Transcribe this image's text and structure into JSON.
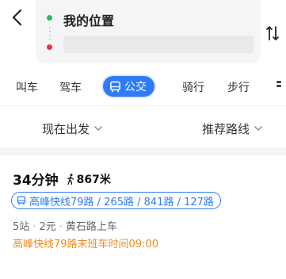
{
  "origin": {
    "label": "我的位置"
  },
  "destination": {
    "value": ""
  },
  "modes": [
    {
      "label": "叫车"
    },
    {
      "label": "驾车"
    },
    {
      "label": "公交"
    },
    {
      "label": "骑行"
    },
    {
      "label": "步行"
    }
  ],
  "filters": {
    "depart": "现在出发",
    "sort": "推荐路线"
  },
  "route": {
    "duration": "34分钟",
    "walk_distance": "867米",
    "lines": "高峰快线79路 / 265路 / 841路 / 127路",
    "stops": "5站",
    "fare": "2元",
    "board_at": "黄石路上车",
    "notice": "高峰快线79路末班车时间09:00"
  },
  "colors": {
    "accent": "#2f7bf5",
    "warning": "#f08a1c",
    "origin_dot": "#20c060",
    "destination_dot": "#ee3344"
  },
  "icons": [
    "back-arrow-icon",
    "swap-icon",
    "bus-icon",
    "more-icon",
    "chevron-down-icon",
    "walk-icon"
  ]
}
